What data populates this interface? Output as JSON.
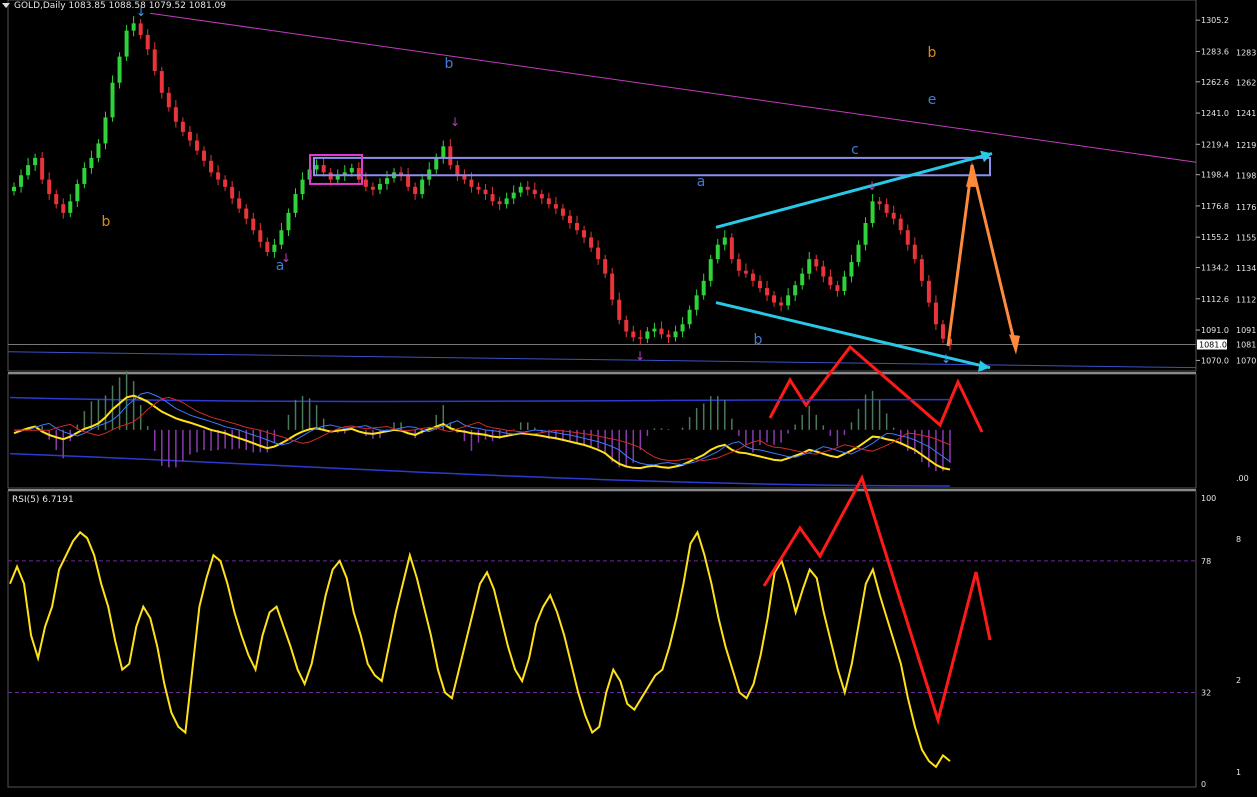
{
  "header": {
    "symbol": "GOLD,Daily",
    "open": "1083.85",
    "high": "1088.58",
    "low": "1079.52",
    "close": "1081.09"
  },
  "rsi_header": "RSI(5) 6.7191",
  "price_axis_ticks": [
    "1305.2",
    "1283.6",
    "1262.6",
    "1241.0",
    "1219.4",
    "1198.4",
    "1176.8",
    "1155.2",
    "1134.2",
    "1112.6",
    "1091.0",
    "1070.0"
  ],
  "current_price_label": "1081.0",
  "right_axis_fragments": [
    "1283.",
    "1262.",
    "1241.",
    "1219.",
    "1198.",
    "1176.",
    "1155.",
    "1134.",
    "1112.",
    "1091.",
    "1081.",
    "1070."
  ],
  "wave_labels": [
    {
      "text": "b",
      "color": "#d98c1a"
    },
    {
      "text": "a",
      "color": "#3f7bd6"
    },
    {
      "text": "b",
      "color": "#3f7bd6"
    },
    {
      "text": "a",
      "color": "#3f7bd6"
    },
    {
      "text": "b",
      "color": "#3f7bd6"
    },
    {
      "text": "c",
      "color": "#3f7bd6"
    },
    {
      "text": "b",
      "color": "#d98c1a"
    },
    {
      "text": "e",
      "color": "#3f7bd6"
    }
  ],
  "osc_axis_label": ".00",
  "rsi_axis_ticks": [
    "100",
    "78",
    "32",
    "0"
  ],
  "rsi_right_fragments": [
    "8",
    "2",
    "1"
  ],
  "colors": {
    "bull": "#2fd23a",
    "bear": "#e8343a",
    "trendline": "#c03cc0",
    "resistance_box": "#8f8ff0",
    "channel": "#29c8e6",
    "projection_up": "#ff8a3c",
    "projection_red": "#ff1a1a",
    "rsi_line": "#ffe11a"
  },
  "chart_data": [
    {
      "type": "candlestick",
      "title": "GOLD,Daily",
      "ylim": [
        1062,
        1315
      ],
      "ohlc_close_series_approx": [
        1190,
        1198,
        1205,
        1210,
        1195,
        1185,
        1178,
        1172,
        1180,
        1192,
        1203,
        1210,
        1220,
        1238,
        1262,
        1280,
        1298,
        1303,
        1295,
        1285,
        1270,
        1255,
        1245,
        1235,
        1228,
        1222,
        1215,
        1208,
        1200,
        1195,
        1190,
        1182,
        1175,
        1168,
        1160,
        1152,
        1145,
        1150,
        1160,
        1172,
        1185,
        1195,
        1202,
        1205,
        1200,
        1195,
        1198,
        1200,
        1203,
        1195,
        1190,
        1188,
        1192,
        1196,
        1200,
        1198,
        1190,
        1185,
        1195,
        1202,
        1210,
        1218,
        1205,
        1198,
        1195,
        1190,
        1188,
        1185,
        1180,
        1178,
        1182,
        1186,
        1190,
        1188,
        1185,
        1182,
        1178,
        1175,
        1170,
        1165,
        1160,
        1155,
        1148,
        1140,
        1130,
        1112,
        1098,
        1090,
        1086,
        1085,
        1090,
        1092,
        1088,
        1086,
        1090,
        1095,
        1105,
        1115,
        1125,
        1140,
        1150,
        1155,
        1140,
        1132,
        1130,
        1125,
        1120,
        1115,
        1110,
        1108,
        1115,
        1122,
        1130,
        1140,
        1135,
        1128,
        1122,
        1118,
        1128,
        1138,
        1150,
        1165,
        1180,
        1178,
        1172,
        1168,
        1160,
        1150,
        1140,
        1125,
        1110,
        1095,
        1085,
        1081
      ],
      "last_close": 1081.09
    },
    {
      "type": "line",
      "title": "RSI(5) 6.7191",
      "ylim": [
        0,
        100
      ],
      "levels": [
        78,
        32
      ],
      "values_approx": [
        70,
        76,
        70,
        52,
        44,
        55,
        62,
        75,
        80,
        85,
        88,
        86,
        80,
        70,
        62,
        50,
        40,
        42,
        55,
        62,
        58,
        48,
        35,
        25,
        20,
        18,
        40,
        62,
        72,
        80,
        78,
        70,
        60,
        52,
        45,
        40,
        52,
        60,
        62,
        55,
        48,
        40,
        35,
        42,
        54,
        66,
        75,
        78,
        72,
        60,
        52,
        42,
        38,
        36,
        48,
        60,
        70,
        80,
        72,
        62,
        52,
        40,
        32,
        30,
        40,
        50,
        60,
        70,
        74,
        68,
        58,
        48,
        40,
        36,
        44,
        56,
        62,
        66,
        60,
        52,
        42,
        32,
        24,
        18,
        20,
        32,
        40,
        36,
        28,
        26,
        30,
        34,
        38,
        40,
        48,
        58,
        70,
        84,
        88,
        80,
        70,
        58,
        48,
        40,
        32,
        30,
        35,
        45,
        58,
        74,
        78,
        70,
        60,
        68,
        75,
        72,
        60,
        50,
        40,
        32,
        42,
        56,
        70,
        75,
        66,
        58,
        50,
        42,
        30,
        20,
        12,
        8,
        6,
        10,
        8
      ]
    }
  ]
}
